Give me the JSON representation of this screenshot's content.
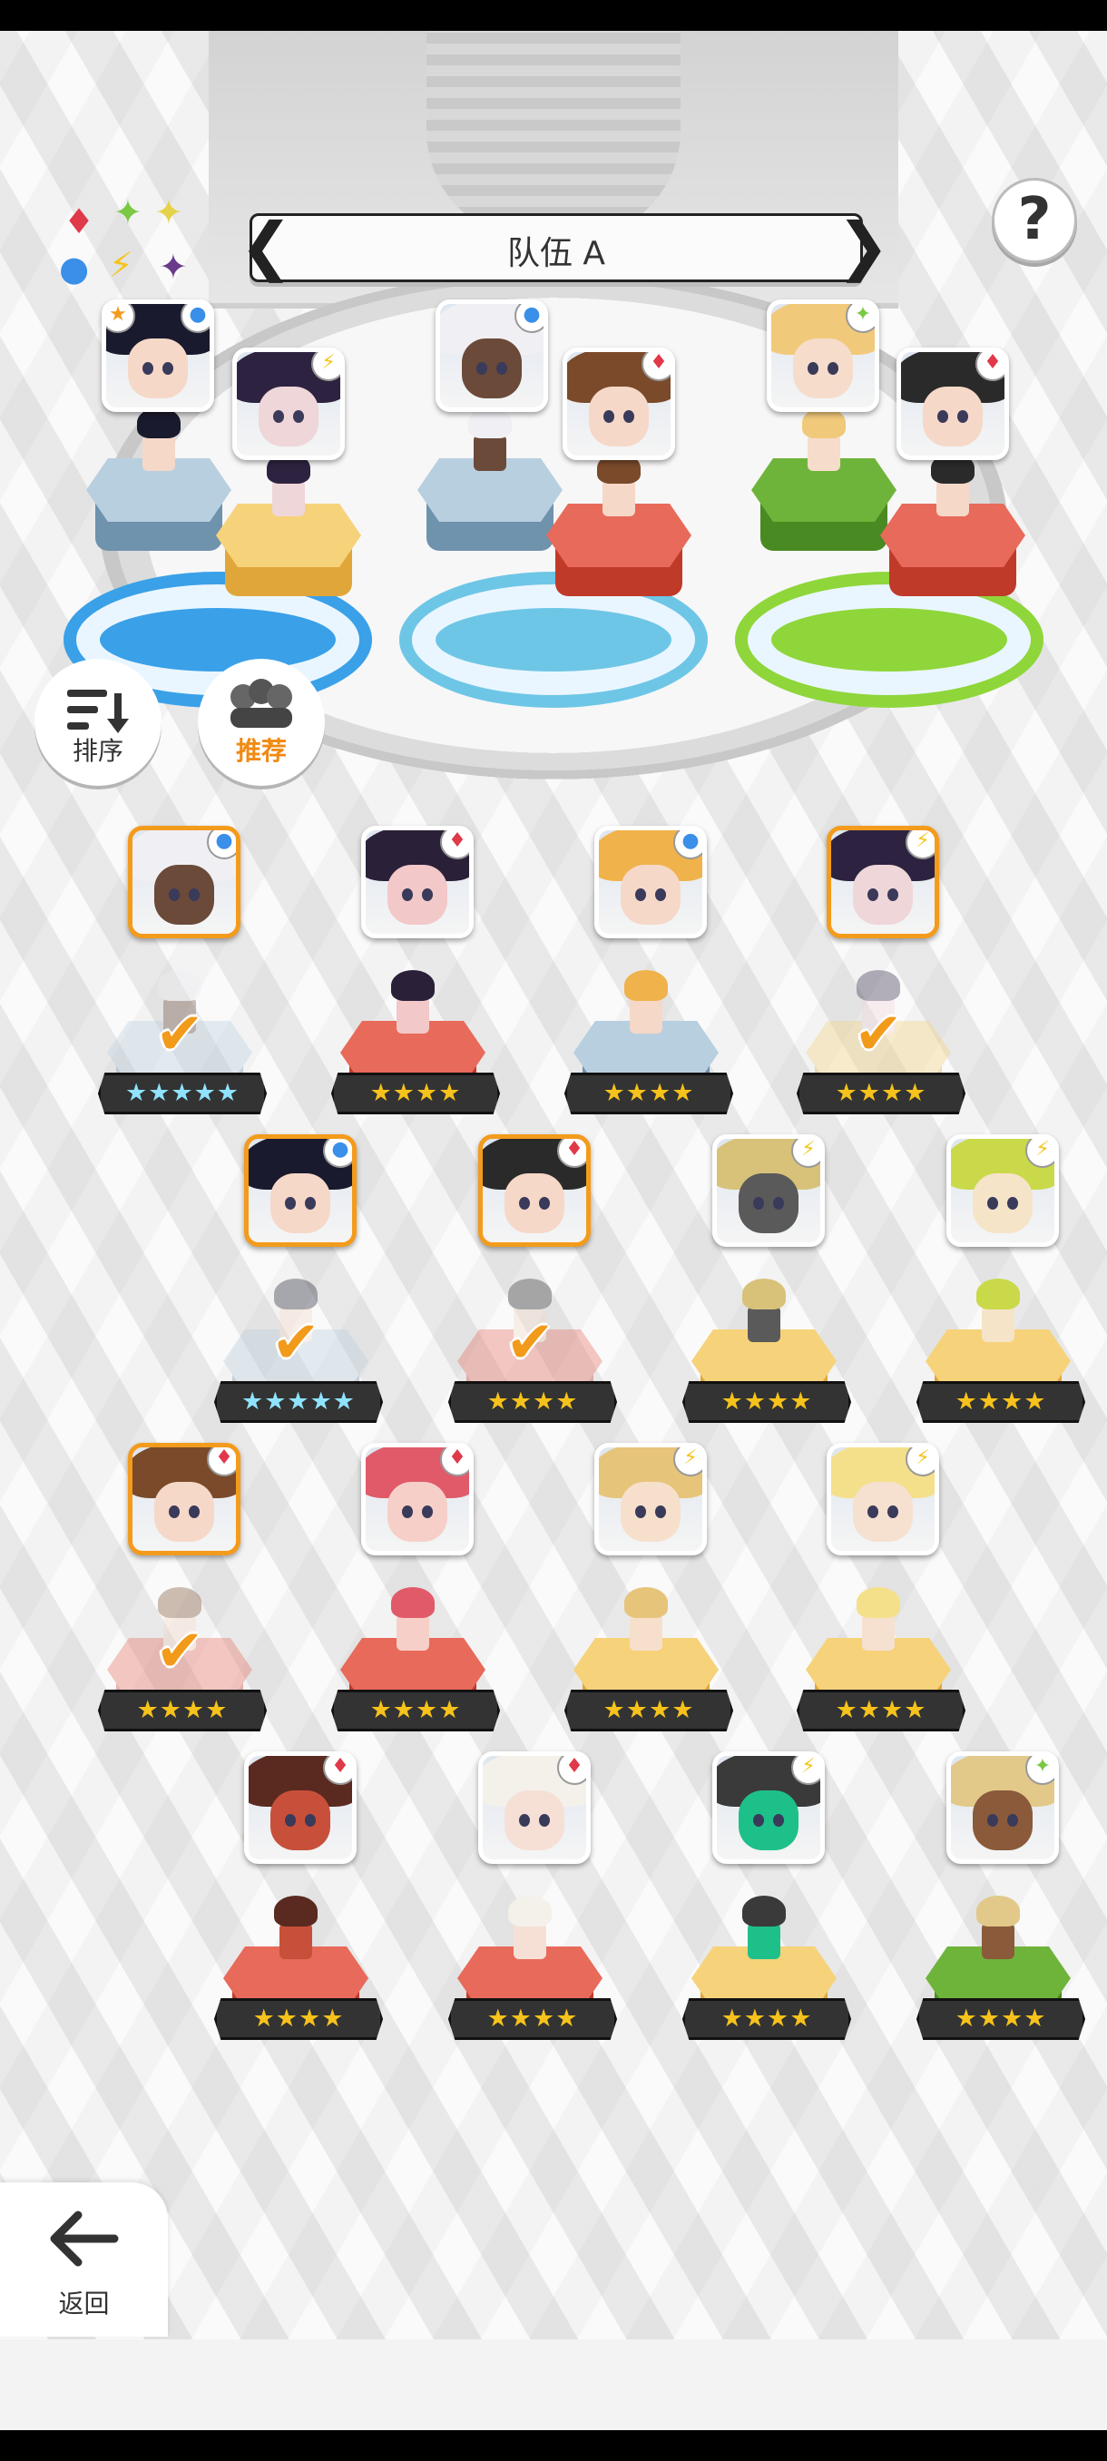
{
  "team": {
    "name": "队伍 A"
  },
  "buttons": {
    "sort_label": "排序",
    "recommend_label": "推荐",
    "back_label": "返回",
    "help_label": "?"
  },
  "legend": {
    "items": [
      {
        "glyph": "♦",
        "color": "#e0394a"
      },
      {
        "glyph": "✦",
        "color": "#7ac943"
      },
      {
        "glyph": "✦",
        "color": "#e6d14a"
      },
      {
        "glyph": "●",
        "color": "#3a8fe8"
      },
      {
        "glyph": "⚡",
        "color": "#f4c51b"
      },
      {
        "glyph": "✦",
        "color": "#6a3a8c"
      }
    ]
  },
  "attributes": {
    "fire": {
      "glyph": "♦",
      "color": "#e0394a"
    },
    "water": {
      "glyph": "●",
      "color": "#3a8fe8"
    },
    "thunder": {
      "glyph": "⚡",
      "color": "#f4c51b"
    },
    "wind": {
      "glyph": "✦",
      "color": "#7ac943"
    }
  },
  "team_slots": [
    {
      "attr": "water",
      "hair": "#1a1a2e",
      "skin": "#f6d8c8",
      "star_badge": "★",
      "ped": "blue",
      "ring": "#3aa0e8"
    },
    {
      "attr": "thunder",
      "hair": "#2d2340",
      "skin": "#efd6d9",
      "ped": "yellow",
      "ring": "#3aa0e8"
    },
    {
      "attr": "water",
      "hair": "#f0f0f4",
      "skin": "#6b4a3a",
      "ped": "blue",
      "ring": "#6ec6e6"
    },
    {
      "attr": "fire",
      "hair": "#7a4a2a",
      "skin": "#f6d8c8",
      "ped": "red",
      "ring": "#6ec6e6"
    },
    {
      "attr": "wind",
      "hair": "#f1c97a",
      "skin": "#f6dccb",
      "ped": "green",
      "ring": "#8fd63a"
    },
    {
      "attr": "fire",
      "hair": "#2a2a2a",
      "skin": "#f6d8c8",
      "ped": "red",
      "ring": "#8fd63a"
    }
  ],
  "roster": [
    {
      "attr": "water",
      "hair": "#f0f0f4",
      "skin": "#6b4a3a",
      "stars": "★★★★★",
      "rainbow": true,
      "selected": true,
      "ped": "blue"
    },
    {
      "attr": "fire",
      "hair": "#2a2038",
      "skin": "#f2c8c8",
      "stars": "★★★★",
      "selected": false,
      "ped": "red"
    },
    {
      "attr": "water",
      "hair": "#f0b24a",
      "skin": "#f6d8c8",
      "stars": "★★★★",
      "selected": false,
      "ped": "blue"
    },
    {
      "attr": "thunder",
      "hair": "#2d2340",
      "skin": "#efd6d9",
      "stars": "★★★★",
      "selected": true,
      "ped": "yellow"
    },
    {
      "attr": "water",
      "hair": "#1a1a2e",
      "skin": "#f6d8c8",
      "stars": "★★★★★",
      "rainbow": true,
      "selected": true,
      "ped": "blue"
    },
    {
      "attr": "fire",
      "hair": "#2a2a2a",
      "skin": "#f6d8c8",
      "stars": "★★★★",
      "selected": true,
      "ped": "red"
    },
    {
      "attr": "thunder",
      "hair": "#d8c27a",
      "skin": "#5a5a5a",
      "stars": "★★★★",
      "selected": false,
      "ped": "yellow"
    },
    {
      "attr": "thunder",
      "hair": "#c9d94a",
      "skin": "#f6e4c8",
      "stars": "★★★★",
      "selected": false,
      "ped": "yellow"
    },
    {
      "attr": "fire",
      "hair": "#7a4a2a",
      "skin": "#f6d8c8",
      "stars": "★★★★",
      "selected": true,
      "ped": "red"
    },
    {
      "attr": "fire",
      "hair": "#e05a6a",
      "skin": "#f6d0c8",
      "stars": "★★★★",
      "selected": false,
      "ped": "red"
    },
    {
      "attr": "thunder",
      "hair": "#e6c47a",
      "skin": "#f6e0cc",
      "stars": "★★★★",
      "selected": false,
      "ped": "yellow"
    },
    {
      "attr": "thunder",
      "hair": "#f4e08a",
      "skin": "#f6e0d0",
      "stars": "★★★★",
      "selected": false,
      "ped": "yellow"
    },
    {
      "attr": "fire",
      "hair": "#5a2a20",
      "skin": "#c8503a",
      "stars": "★★★★",
      "selected": false,
      "ped": "red"
    },
    {
      "attr": "fire",
      "hair": "#f4f0ea",
      "skin": "#f6e0d6",
      "stars": "★★★★",
      "selected": false,
      "ped": "red"
    },
    {
      "attr": "thunder",
      "hair": "#3a3a3a",
      "skin": "#1ec08a",
      "stars": "★★★★",
      "selected": false,
      "ped": "yellow"
    },
    {
      "attr": "wind",
      "hair": "#e2c98a",
      "skin": "#8a5a3a",
      "stars": "★★★★",
      "selected": false,
      "ped": "green"
    }
  ]
}
